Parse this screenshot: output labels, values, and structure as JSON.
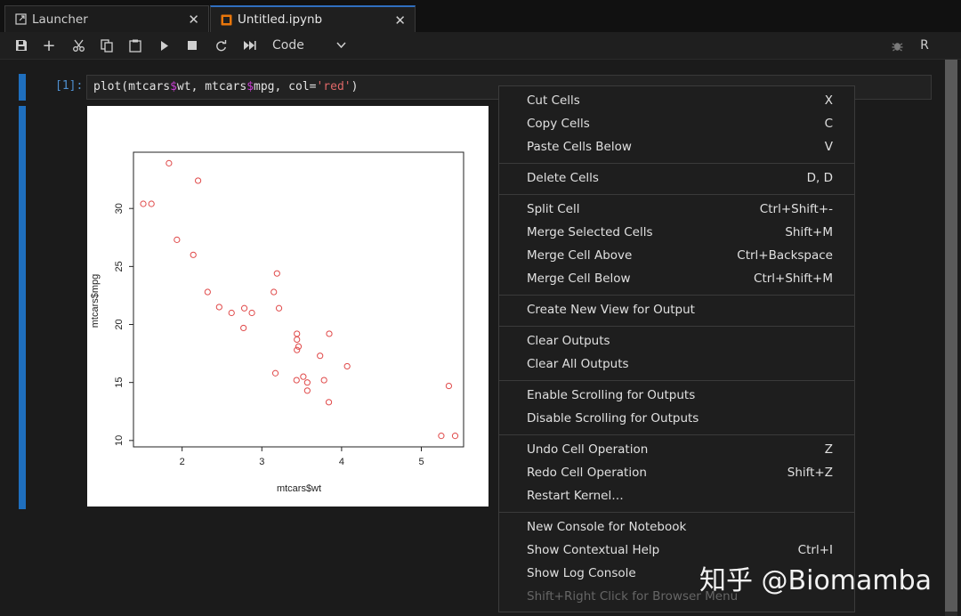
{
  "tabs": [
    {
      "label": "Launcher",
      "icon": "launcher-icon"
    },
    {
      "label": "Untitled.ipynb",
      "icon": "notebook-icon"
    }
  ],
  "toolbar": {
    "cell_type": "Code",
    "kernel_label": "R",
    "icons": [
      "save-icon",
      "add-icon",
      "cut-icon",
      "copy-icon",
      "paste-icon",
      "run-icon",
      "stop-icon",
      "restart-icon",
      "fast-forward-icon",
      "chevron-down-icon",
      "bug-icon"
    ]
  },
  "cell": {
    "prompt": "[1]:",
    "code": {
      "t1": "plot(mtcars",
      "op1": "$",
      "t2": "wt, mtcars",
      "op2": "$",
      "t3": "mpg, col=",
      "str": "'red'",
      "t4": ")"
    }
  },
  "chart_data": {
    "type": "scatter",
    "title": "",
    "xlabel": "mtcars$wt",
    "ylabel": "mtcars$mpg",
    "xlim": [
      1.5,
      5.42
    ],
    "ylim": [
      10.4,
      33.9
    ],
    "xticks": [
      "2",
      "3",
      "4",
      "5"
    ],
    "yticks": [
      "10",
      "15",
      "20",
      "25",
      "30"
    ],
    "marker_color": "#e04a4a",
    "points": [
      [
        2.62,
        21.0
      ],
      [
        2.875,
        21.0
      ],
      [
        2.32,
        22.8
      ],
      [
        3.215,
        21.4
      ],
      [
        3.44,
        18.7
      ],
      [
        3.46,
        18.1
      ],
      [
        3.57,
        14.3
      ],
      [
        3.19,
        24.4
      ],
      [
        3.15,
        22.8
      ],
      [
        3.44,
        19.2
      ],
      [
        3.44,
        17.8
      ],
      [
        4.07,
        16.4
      ],
      [
        3.73,
        17.3
      ],
      [
        3.78,
        15.2
      ],
      [
        5.25,
        10.4
      ],
      [
        5.424,
        10.4
      ],
      [
        5.345,
        14.7
      ],
      [
        2.2,
        32.4
      ],
      [
        1.615,
        30.4
      ],
      [
        1.835,
        33.9
      ],
      [
        2.465,
        21.5
      ],
      [
        3.52,
        15.5
      ],
      [
        3.435,
        15.2
      ],
      [
        3.84,
        13.3
      ],
      [
        3.845,
        19.2
      ],
      [
        1.935,
        27.3
      ],
      [
        2.14,
        26.0
      ],
      [
        1.513,
        30.4
      ],
      [
        3.17,
        15.8
      ],
      [
        2.77,
        19.7
      ],
      [
        3.57,
        15.0
      ],
      [
        2.78,
        21.4
      ]
    ]
  },
  "context_menu": {
    "groups": [
      [
        {
          "label": "Cut Cells",
          "shortcut": "X"
        },
        {
          "label": "Copy Cells",
          "shortcut": "C"
        },
        {
          "label": "Paste Cells Below",
          "shortcut": "V"
        }
      ],
      [
        {
          "label": "Delete Cells",
          "shortcut": "D, D"
        }
      ],
      [
        {
          "label": "Split Cell",
          "shortcut": "Ctrl+Shift+-"
        },
        {
          "label": "Merge Selected Cells",
          "shortcut": "Shift+M"
        },
        {
          "label": "Merge Cell Above",
          "shortcut": "Ctrl+Backspace"
        },
        {
          "label": "Merge Cell Below",
          "shortcut": "Ctrl+Shift+M"
        }
      ],
      [
        {
          "label": "Create New View for Output",
          "shortcut": ""
        }
      ],
      [
        {
          "label": "Clear Outputs",
          "shortcut": ""
        },
        {
          "label": "Clear All Outputs",
          "shortcut": ""
        }
      ],
      [
        {
          "label": "Enable Scrolling for Outputs",
          "shortcut": ""
        },
        {
          "label": "Disable Scrolling for Outputs",
          "shortcut": ""
        }
      ],
      [
        {
          "label": "Undo Cell Operation",
          "shortcut": "Z"
        },
        {
          "label": "Redo Cell Operation",
          "shortcut": "Shift+Z"
        },
        {
          "label": "Restart Kernel…",
          "shortcut": ""
        }
      ],
      [
        {
          "label": "New Console for Notebook",
          "shortcut": ""
        },
        {
          "label": "Show Contextual Help",
          "shortcut": "Ctrl+I"
        },
        {
          "label": "Show Log Console",
          "shortcut": ""
        },
        {
          "label": "Shift+Right Click for Browser Menu",
          "shortcut": "",
          "disabled": true
        }
      ]
    ]
  },
  "watermark": "知乎 @Biomamba"
}
